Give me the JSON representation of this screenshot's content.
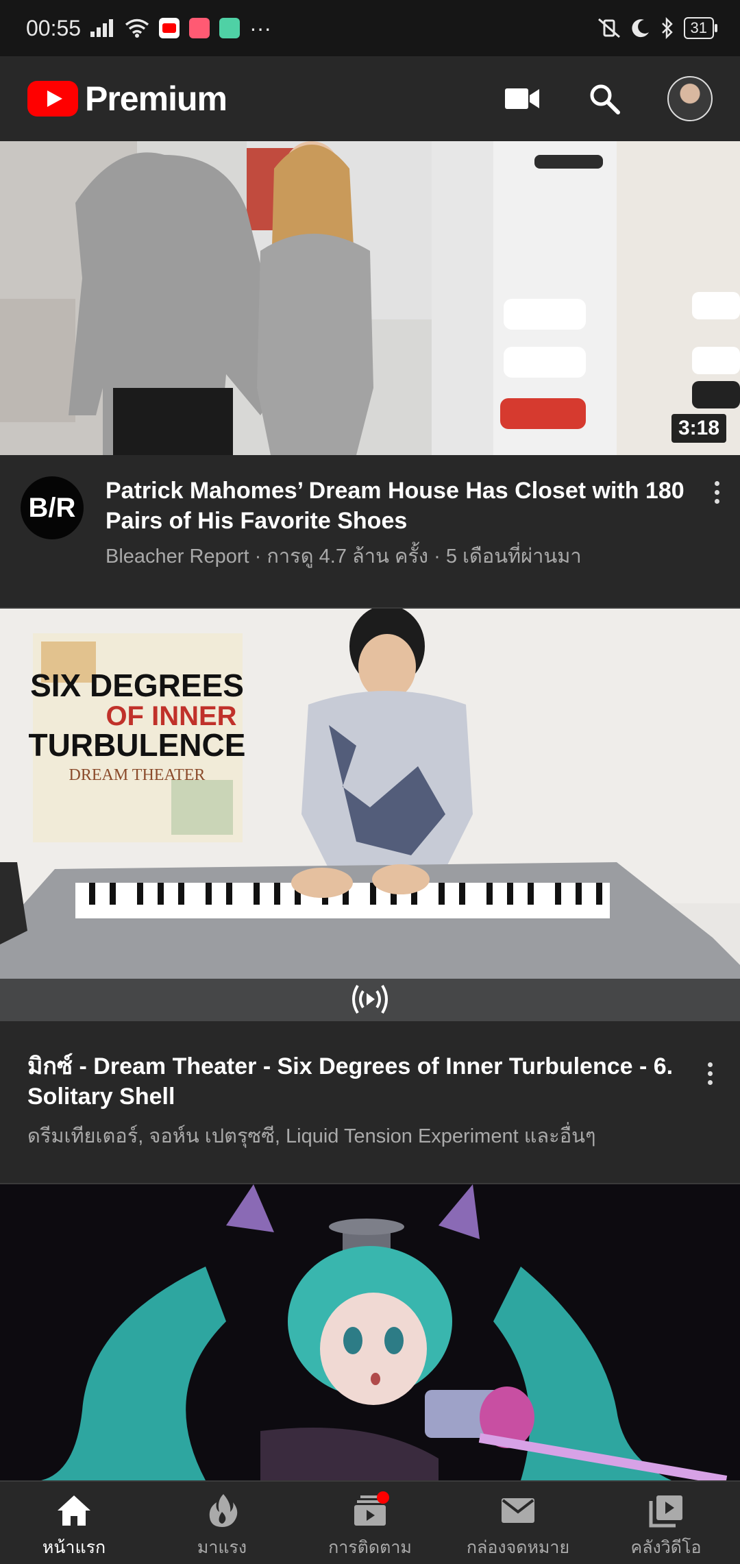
{
  "status_bar": {
    "time": "00:55",
    "battery": "31",
    "more": "···"
  },
  "header": {
    "brand": "Premium",
    "icons": [
      "camera-icon",
      "search-icon",
      "account-avatar"
    ]
  },
  "feed": [
    {
      "title": "Patrick Mahomes’ Dream House Has Closet with 180 Pairs of His Favorite Shoes",
      "channel_initials": "B/R",
      "meta": "Bleacher Report · การดู 4.7 ล้าน ครั้ง · 5 เดือนที่ผ่านมา",
      "duration": "3:18"
    },
    {
      "title": "มิกซ์ - Dream Theater - Six Degrees of Inner Turbulence - 6. Solitary Shell",
      "meta": "ดรีมเทียเตอร์, จอห์น เปตรุซซี, Liquid Tension Experiment และอื่นๆ",
      "album_text_1": "SIX DEGREES",
      "album_text_2": "OF INNER",
      "album_text_3": "TURBULENCE",
      "album_text_4": "DREAM THEATER"
    },
    {
      "title": ""
    }
  ],
  "bottom_nav": [
    {
      "label": "หน้าแรก",
      "icon": "home-icon",
      "active": true
    },
    {
      "label": "มาแรง",
      "icon": "fire-icon",
      "active": false
    },
    {
      "label": "การติดตาม",
      "icon": "subscriptions-icon",
      "active": false
    },
    {
      "label": "กล่องจดหมาย",
      "icon": "inbox-icon",
      "active": false
    },
    {
      "label": "คลังวิดีโอ",
      "icon": "library-icon",
      "active": false
    }
  ],
  "colors": {
    "brand_red": "#ff0000",
    "background": "#181818",
    "surface": "#282828",
    "meta_text": "#aaaaaa"
  }
}
